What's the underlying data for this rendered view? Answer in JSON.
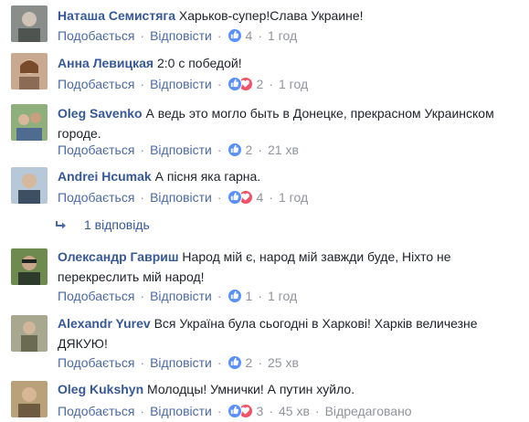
{
  "labels": {
    "like": "Подобається",
    "reply": "Відповісти",
    "dot": "·",
    "edited": "Відредаговано"
  },
  "colors": {
    "author": "#365899",
    "action": "#4b6aa8",
    "meta": "#90949c",
    "like_icon": "#5890ff",
    "love_icon": "#f25268"
  },
  "comments": [
    {
      "author": "Наташа Семистяга",
      "text": "Харьков-супер!Слава Украине!",
      "reactions": [
        "like"
      ],
      "count": "4",
      "time": "1 год"
    },
    {
      "author": "Анна Левицкая",
      "text": "2:0 с победой!",
      "reactions": [
        "like",
        "love"
      ],
      "count": "2",
      "time": "1 год"
    },
    {
      "author": "Oleg Savenko",
      "text": "А ведь это могло быть в Донецке, прекрасном Украинском городе.",
      "reactions": [
        "like"
      ],
      "count": "2",
      "time": "21 хв"
    },
    {
      "author": "Andrei Hcumak",
      "text": "А пісня яка гарна.",
      "reactions": [
        "like",
        "love"
      ],
      "count": "4",
      "time": "1 год"
    },
    {
      "author": "Олександр Гавриш",
      "text": "Народ мій є, народ мій завжди буде, Ніхто не перекреслить мій народ!",
      "reactions": [
        "like"
      ],
      "count": "1",
      "time": "1 год"
    },
    {
      "author": "Alexandr Yurev",
      "text": "Вся Україна була сьогодні в Харкові! Харків величезне ДЯКУЮ!",
      "reactions": [
        "like"
      ],
      "count": "2",
      "time": "25 хв"
    },
    {
      "author": "Oleg Kukshyn",
      "text": "Молодцы! Умнички! А путин хуйло.",
      "reactions": [
        "like",
        "love"
      ],
      "count": "3",
      "time": "45 хв",
      "edited": true
    }
  ],
  "replies_link": "1 відповідь"
}
